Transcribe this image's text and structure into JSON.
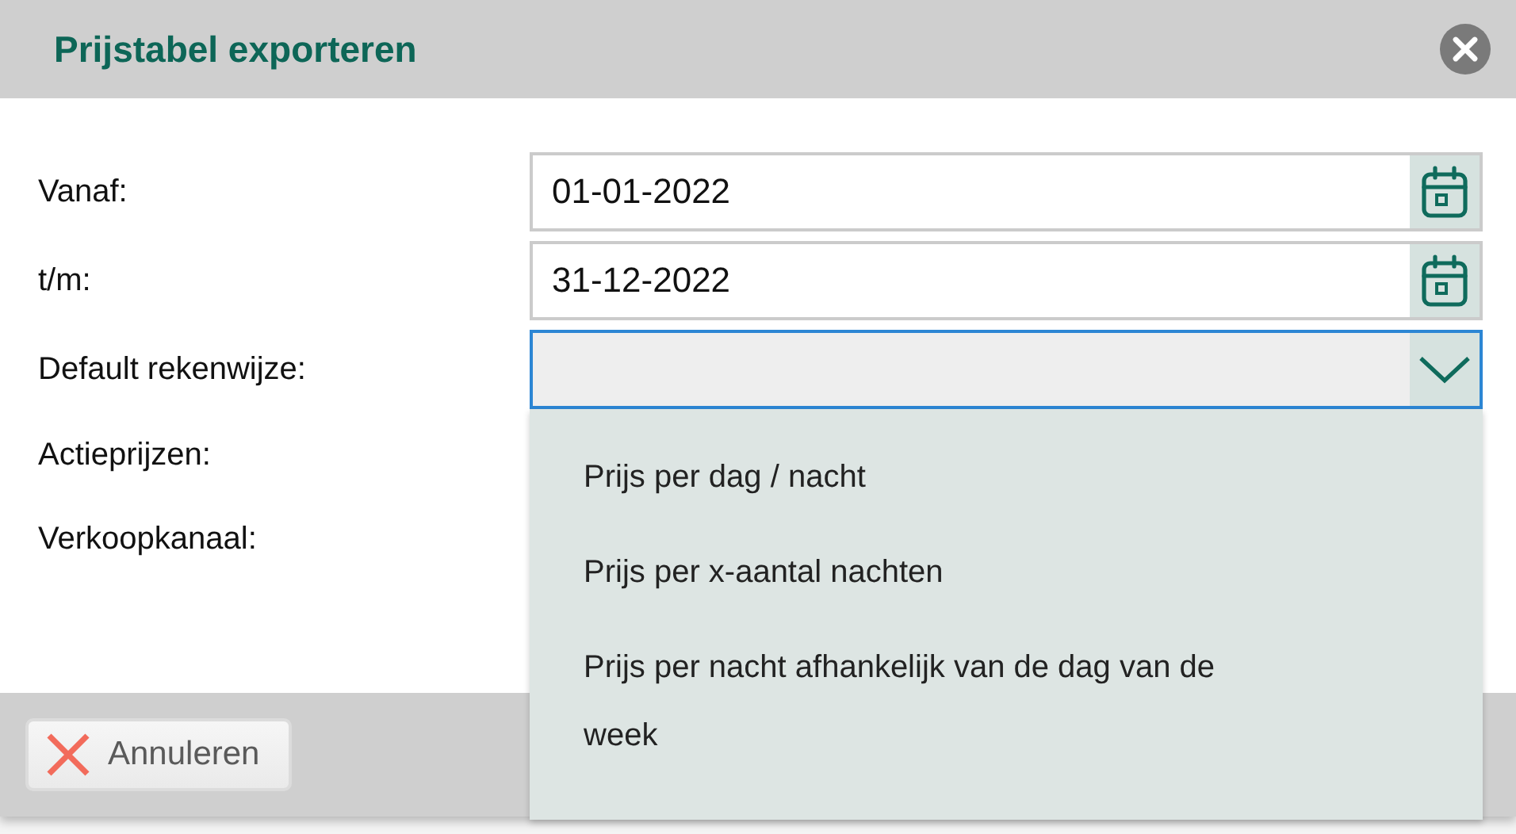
{
  "dialog": {
    "title": "Prijstabel exporteren"
  },
  "fields": [
    {
      "label": "Vanaf:",
      "kind": "date",
      "value": "01-01-2022"
    },
    {
      "label": "t/m:",
      "kind": "date",
      "value": "31-12-2022"
    },
    {
      "label": "Default rekenwijze:",
      "kind": "select",
      "expanded": true
    },
    {
      "label": "Actieprijzen:",
      "kind": "label"
    },
    {
      "label": "Verkoopkanaal:",
      "kind": "label"
    }
  ],
  "dropdown_options": [
    {
      "label": "Prijs per dag / nacht"
    },
    {
      "label": "Prijs per x-aantal nachten"
    },
    {
      "label": "Prijs per nacht afhankelijk van de dag van de week"
    }
  ],
  "buttons": [
    {
      "label": "Annuleren",
      "kind": "cancel"
    }
  ]
}
